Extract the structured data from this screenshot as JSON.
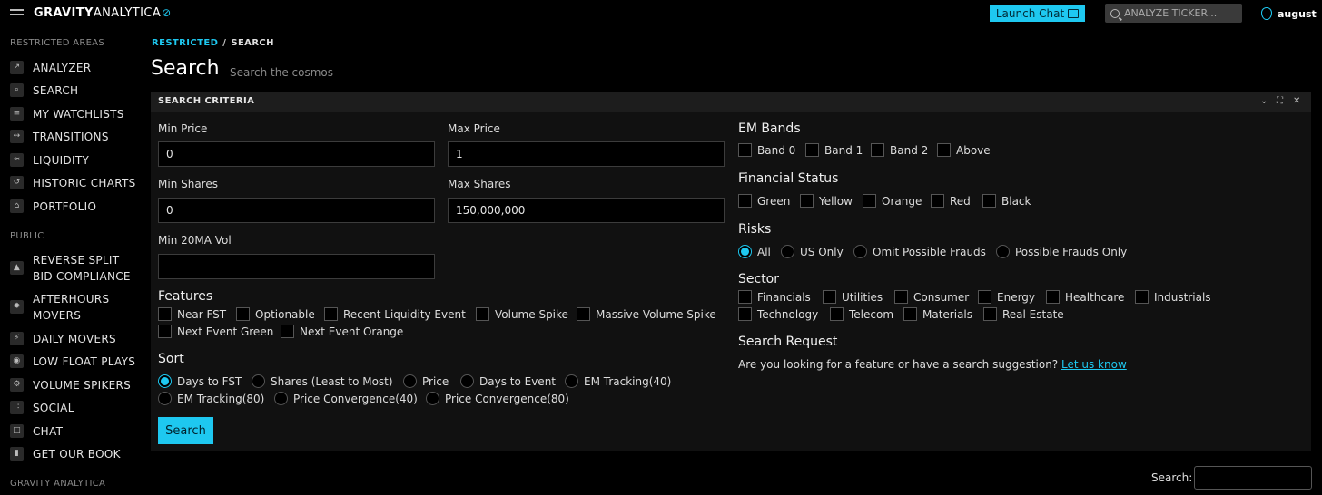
{
  "header": {
    "logo_bold": "GRAVITY",
    "logo_light": "ANALYTICA",
    "launch_chat": "Launch Chat",
    "ticker_placeholder": "ANALYZE TICKER...",
    "username": "august"
  },
  "sidebar": {
    "section_restricted": "RESTRICTED AREAS",
    "restricted_items": [
      {
        "label": "ANALYZER",
        "icon": "chart-icon"
      },
      {
        "label": "SEARCH",
        "icon": "search-icon"
      },
      {
        "label": "MY WATCHLISTS",
        "icon": "watchlist-icon"
      },
      {
        "label": "TRANSITIONS",
        "icon": "transitions-icon"
      },
      {
        "label": "LIQUIDITY",
        "icon": "liquidity-icon"
      },
      {
        "label": "HISTORIC CHARTS",
        "icon": "history-icon"
      },
      {
        "label": "PORTFOLIO",
        "icon": "bank-icon"
      }
    ],
    "section_public": "PUBLIC",
    "public_items": [
      {
        "label_1": "REVERSE SPLIT",
        "label_2": "BID COMPLIANCE",
        "icon": "rocket-icon"
      },
      {
        "label_1": "AFTERHOURS",
        "label_2": "MOVERS",
        "icon": "star-icon"
      },
      {
        "label_1": "DAILY MOVERS",
        "icon": "bolt-icon"
      },
      {
        "label_1": "LOW FLOAT PLAYS",
        "icon": "eye-icon"
      },
      {
        "label_1": "VOLUME SPIKERS",
        "icon": "gear-icon"
      },
      {
        "label_1": "SOCIAL",
        "icon": "people-icon"
      },
      {
        "label_1": "CHAT",
        "icon": "chat-icon"
      },
      {
        "label_1": "GET OUR BOOK",
        "icon": "book-icon"
      }
    ],
    "section_footer": "GRAVITY ANALYTICA"
  },
  "breadcrumb": {
    "parent": "RESTRICTED",
    "sep": "/",
    "current": "SEARCH"
  },
  "page": {
    "title": "Search",
    "subtitle": "Search the cosmos"
  },
  "panel": {
    "title": "SEARCH CRITERIA",
    "min_price": {
      "label": "Min Price",
      "value": "0"
    },
    "max_price": {
      "label": "Max Price",
      "value": "1"
    },
    "min_shares": {
      "label": "Min Shares",
      "value": "0"
    },
    "max_shares": {
      "label": "Max Shares",
      "value": "150,000,000"
    },
    "min_20ma": {
      "label": "Min 20MA Vol",
      "value": ""
    },
    "features": {
      "heading": "Features",
      "options": [
        "Near FST",
        "Optionable",
        "Recent Liquidity Event",
        "Volume Spike",
        "Massive Volume Spike",
        "Next Event Green",
        "Next Event Orange"
      ]
    },
    "sort": {
      "heading": "Sort",
      "options": [
        "Days to FST",
        "Shares (Least to Most)",
        "Price",
        "Days to Event",
        "EM Tracking(40)",
        "EM Tracking(80)",
        "Price Convergence(40)",
        "Price Convergence(80)"
      ],
      "selected": "Days to FST"
    },
    "search_button": "Search",
    "em_bands": {
      "heading": "EM Bands",
      "options": [
        "Band 0",
        "Band 1",
        "Band 2",
        "Above"
      ]
    },
    "financial_status": {
      "heading": "Financial Status",
      "options": [
        "Green",
        "Yellow",
        "Orange",
        "Red",
        "Black"
      ]
    },
    "risks": {
      "heading": "Risks",
      "options": [
        "All",
        "US Only",
        "Omit Possible Frauds",
        "Possible Frauds Only"
      ],
      "selected": "All"
    },
    "sector": {
      "heading": "Sector",
      "options": [
        "Financials",
        "Utilities",
        "Consumer",
        "Energy",
        "Healthcare",
        "Industrials",
        "Technology",
        "Telecom",
        "Materials",
        "Real Estate"
      ]
    },
    "search_request": {
      "heading": "Search Request",
      "text": "Are you looking for a feature or have a search suggestion?",
      "link": "Let us know"
    }
  },
  "footer": {
    "search_label": "Search:"
  }
}
